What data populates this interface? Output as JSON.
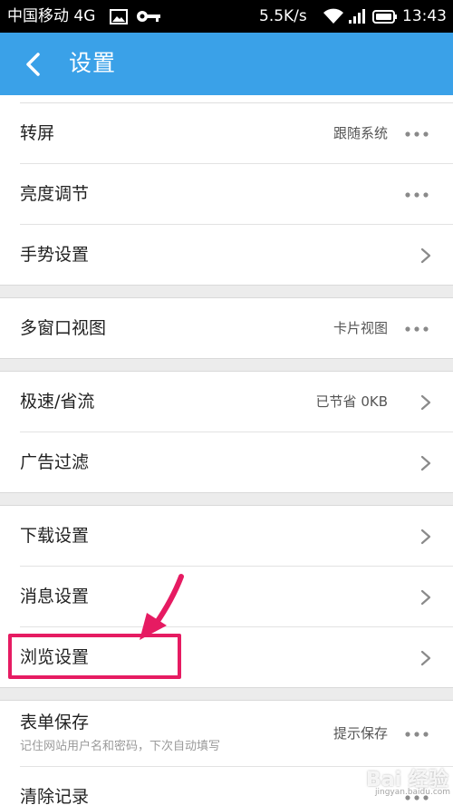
{
  "status_bar": {
    "carrier": "中国移动 4G",
    "net_speed": "5.5K/s",
    "time": "13:43"
  },
  "app_bar": {
    "title": "设置"
  },
  "groups": [
    {
      "items": [
        {
          "label": "转屏",
          "value": "跟随系统",
          "control": "more"
        },
        {
          "label": "亮度调节",
          "value": "",
          "control": "more"
        },
        {
          "label": "手势设置",
          "value": "",
          "control": "chevron"
        }
      ]
    },
    {
      "items": [
        {
          "label": "多窗口视图",
          "value": "卡片视图",
          "control": "more"
        }
      ]
    },
    {
      "items": [
        {
          "label": "极速/省流",
          "value": "已节省 0KB",
          "control": "chevron"
        },
        {
          "label": "广告过滤",
          "value": "",
          "control": "chevron"
        }
      ]
    },
    {
      "items": [
        {
          "label": "下载设置",
          "value": "",
          "control": "chevron"
        },
        {
          "label": "消息设置",
          "value": "",
          "control": "chevron"
        },
        {
          "label": "浏览设置",
          "value": "",
          "control": "chevron",
          "highlighted": true
        }
      ]
    },
    {
      "items": [
        {
          "label": "表单保存",
          "sub": "记住网站用户名和密码，下次自动填写",
          "value": "提示保存",
          "control": "more"
        },
        {
          "label": "清除记录",
          "value": "",
          "control": "more"
        }
      ]
    }
  ],
  "annotation": {
    "color": "#e61b62"
  },
  "watermark": {
    "text": "Bai 经验",
    "sub": "jingyan.baidu.com"
  },
  "colors": {
    "app_bar": "#3aa1e8",
    "background": "#ececec",
    "row_background": "#ffffff"
  }
}
